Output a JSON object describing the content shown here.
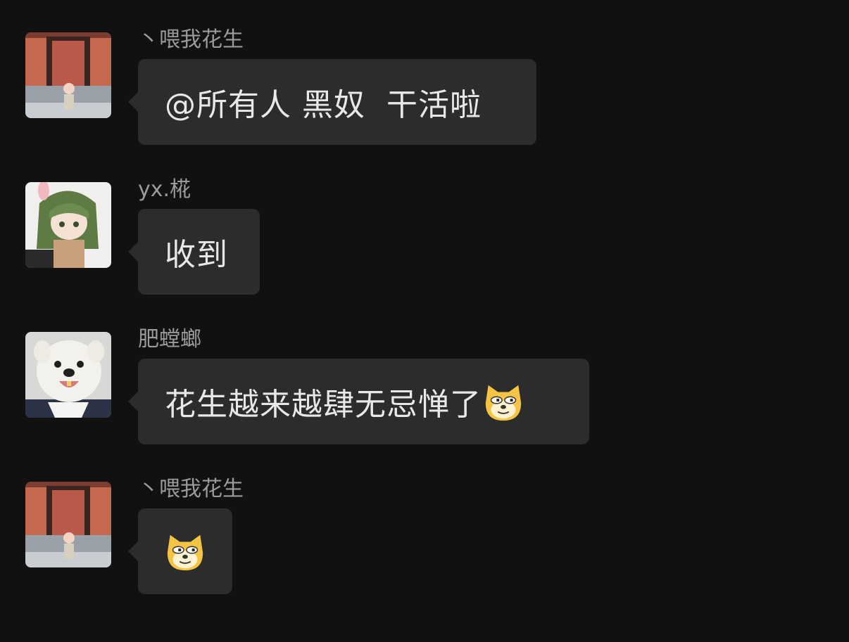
{
  "messages": [
    {
      "sender": "丶喂我花生",
      "text": "@所有人 黑奴  干活啦",
      "avatar": "photo-doorway-avatar"
    },
    {
      "sender": "yx.椛",
      "text": "收到",
      "avatar": "anime-green-hair-avatar"
    },
    {
      "sender": "肥螳螂",
      "text": "花生越来越肆无忌惮了",
      "avatar": "white-dog-avatar",
      "trailing_emoji": "doge-face-icon"
    },
    {
      "sender": "丶喂我花生",
      "text": "",
      "avatar": "photo-doorway-avatar",
      "trailing_emoji": "doge-face-icon"
    }
  ],
  "colors": {
    "background": "#111111",
    "bubble": "#2c2c2c",
    "sender_text": "#9b9b9b",
    "message_text": "#e8e8e8"
  }
}
